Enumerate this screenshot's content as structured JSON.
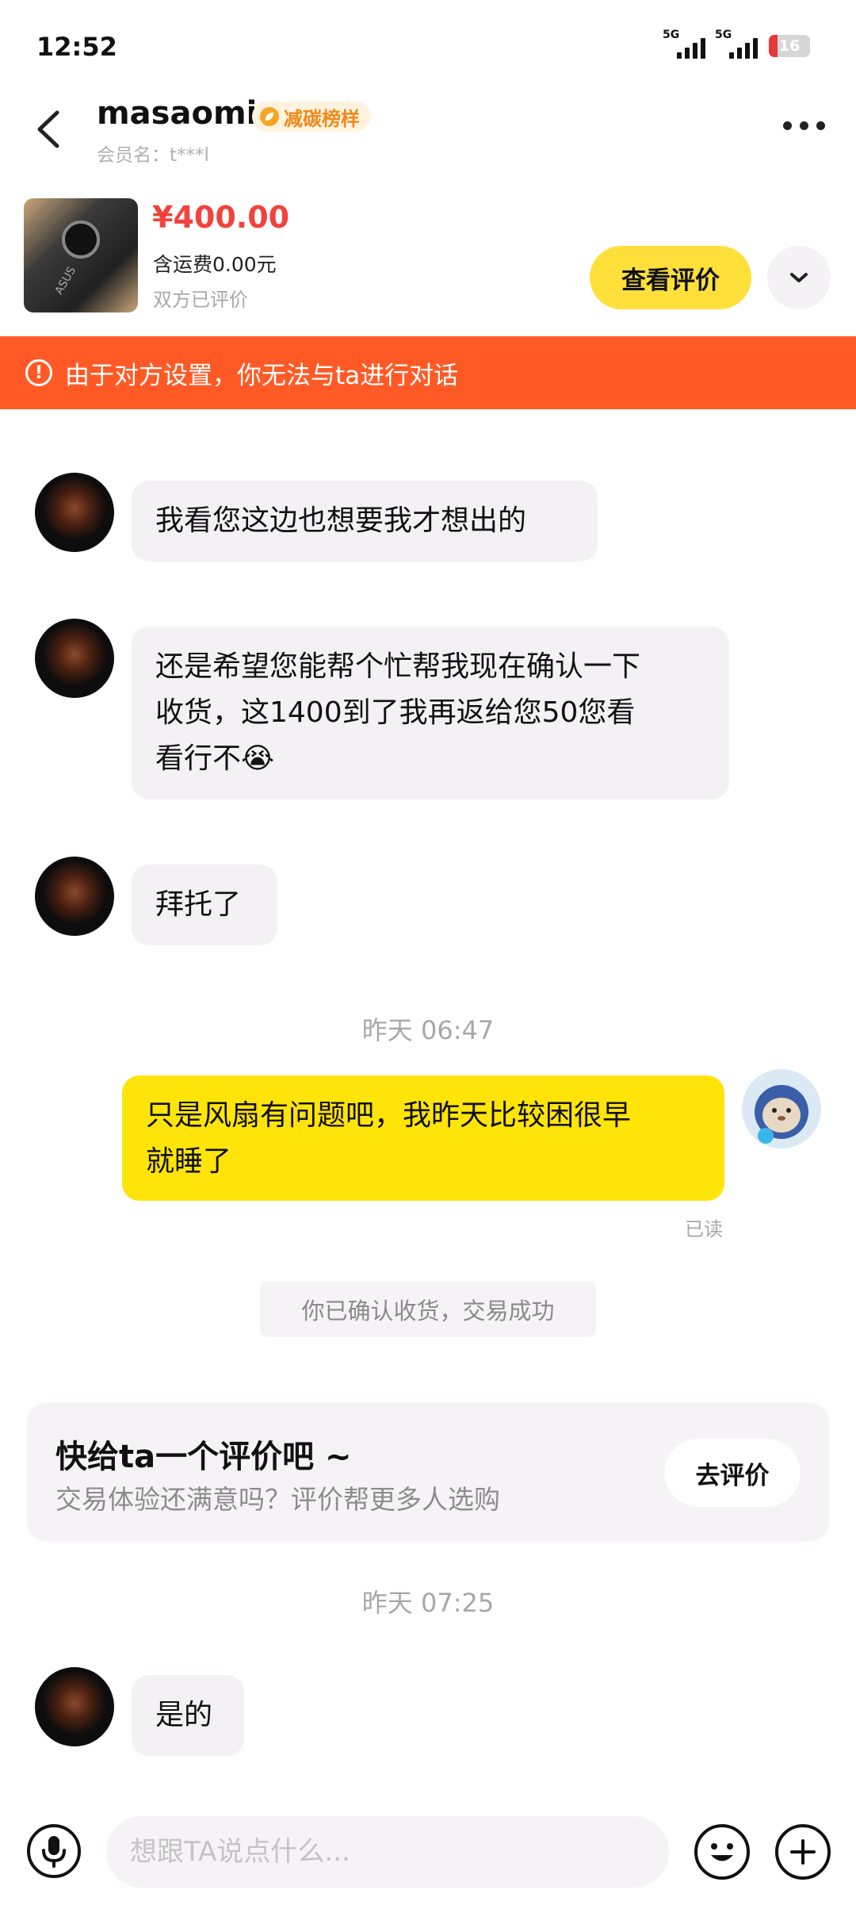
{
  "status_bar": {
    "time": "12:52",
    "net1": "5G",
    "net2": "5G",
    "battery": "16"
  },
  "header": {
    "username": "masaomi",
    "badge": "减碳榜样",
    "member": "会员名：t***l"
  },
  "product": {
    "price": "¥400.00",
    "shipping": "含运费0.00元",
    "status": "双方已评价",
    "view_review_label": "查看评价"
  },
  "banner": {
    "text": "由于对方设置，你无法与ta进行对话"
  },
  "messages": [
    {
      "text": "我看您这边也想要我才想出的"
    },
    {
      "line1": "还是希望您能帮个忙帮我现在确认一下",
      "line2": "收货，这1400到了我再返给您50您看",
      "line3": "看行不",
      "emoji": "😭"
    },
    {
      "text": "拜托了"
    }
  ],
  "time1": "昨天 06:47",
  "my_message": {
    "line1": "只是风扇有问题吧，我昨天比较困很早",
    "line2": "就睡了",
    "read": "已读"
  },
  "system_message": "你已确认收货，交易成功",
  "review_card": {
    "title": "快给ta一个评价吧 ~",
    "subtitle": "交易体验还满意吗？评价帮更多人选购",
    "button": "去评价"
  },
  "time2": "昨天 07:25",
  "last_message": "是的",
  "input": {
    "placeholder": "想跟TA说点什么..."
  }
}
